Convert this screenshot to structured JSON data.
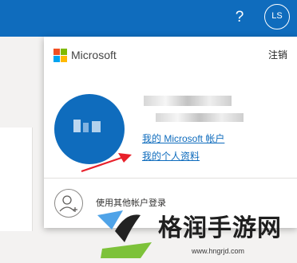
{
  "header": {
    "help_label": "?",
    "account_initials": "LS"
  },
  "account_panel": {
    "brand": "Microsoft",
    "signout_label": "注销",
    "links": {
      "my_account": "我的 Microsoft 帐户",
      "my_profile": "我的个人资料"
    },
    "other_account_label": "使用其他帐户登录"
  },
  "watermark": {
    "title": "格润手游网",
    "url": "www.hngrjd.com"
  },
  "colors": {
    "accent": "#0f6cbd",
    "annotation_arrow": "#e8202a"
  }
}
